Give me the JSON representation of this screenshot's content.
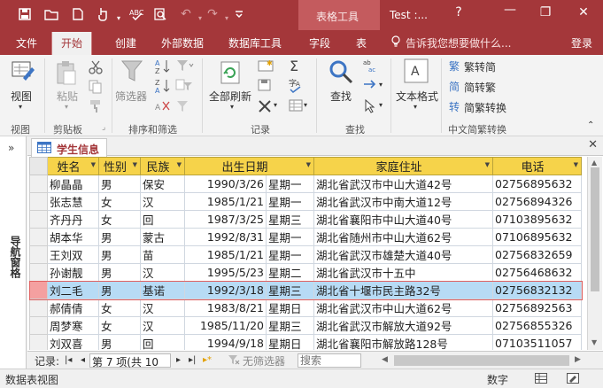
{
  "titlebar": {
    "context_tab": "表格工具",
    "doc_title": "Test :...",
    "help": "?",
    "minimize": "—",
    "restore": "❐",
    "close": "✕"
  },
  "tabs": {
    "file": "文件",
    "home": "开始",
    "create": "创建",
    "external_data": "外部数据",
    "database_tools": "数据库工具",
    "fields": "字段",
    "table": "表",
    "tell_me": "告诉我您想要做什么...",
    "login": "登录"
  },
  "ribbon": {
    "view_btn": "视图",
    "paste_btn": "粘贴",
    "filter_btn": "筛选器",
    "refresh_btn": "全部刷新",
    "find_btn": "查找",
    "text_format_btn": "文本格式",
    "trad_conv": "繁转简",
    "simp_conv": "简转繁",
    "conv_btn": "简繁转换",
    "groups": {
      "view": "视图",
      "clipboard": "剪贴板",
      "sort_filter": "排序和筛选",
      "records": "记录",
      "find": "查找",
      "conversion": "中文简繁转换"
    }
  },
  "nav": {
    "toggle": "»",
    "label": "导航窗格"
  },
  "object_tab": {
    "title": "学生信息",
    "close": "✕"
  },
  "table": {
    "columns": [
      "姓名",
      "性别",
      "民族",
      "出生日期",
      "家庭住址",
      "电话"
    ],
    "rows": [
      [
        "柳晶晶",
        "男",
        "保安",
        "1990/3/26",
        "星期一",
        "湖北省武汉市中山大道42号",
        "02756895632"
      ],
      [
        "张志慧",
        "女",
        "汉",
        "1985/1/21",
        "星期一",
        "湖北省武汉市中南大道12号",
        "02756894326"
      ],
      [
        "齐丹丹",
        "女",
        "回",
        "1987/3/25",
        "星期三",
        "湖北省襄阳市中山大道40号",
        "07103895632"
      ],
      [
        "胡本华",
        "男",
        "蒙古",
        "1992/8/31",
        "星期一",
        "湖北省随州市中山大道62号",
        "07106895632"
      ],
      [
        "王刘双",
        "男",
        "苗",
        "1985/1/21",
        "星期一",
        "湖北省武汉市雄楚大道40号",
        "02756832659"
      ],
      [
        "孙谢靓",
        "男",
        "汉",
        "1995/5/23",
        "星期二",
        "湖北省武汉市十五中",
        "02756468632"
      ],
      [
        "刘二毛",
        "男",
        "基诺",
        "1992/3/18",
        "星期三",
        "湖北省十堰市民主路32号",
        "02756832132"
      ],
      [
        "郝倩倩",
        "女",
        "汉",
        "1983/8/21",
        "星期日",
        "湖北省武汉市中山大道62号",
        "02756892563"
      ],
      [
        "周梦寒",
        "女",
        "汉",
        "1985/11/20",
        "星期三",
        "湖北省武汉市解放大道92号",
        "02756855326"
      ],
      [
        "刘双喜",
        "男",
        "回",
        "1994/9/18",
        "星期日",
        "湖北省襄阳市解放路128号",
        "07103511057"
      ]
    ],
    "new_row_marker": "*",
    "current_row_index": 6
  },
  "record_nav": {
    "label": "记录:",
    "first": "|◂",
    "prev": "◂",
    "position": "第 7 项(共 10 项",
    "next": "▸",
    "last": "▸|",
    "new": "▸*",
    "no_filter": "无筛选器",
    "search_placeholder": "搜索"
  },
  "statusbar": {
    "view": "数据表视图",
    "numlock": "数字"
  }
}
